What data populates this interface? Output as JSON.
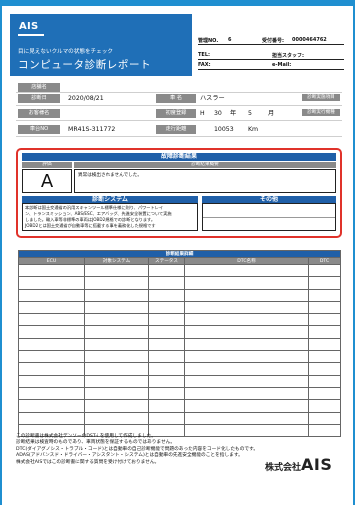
{
  "header": {
    "logo_text": "AIS",
    "tagline": "目に見えないクルマの状態をチェック",
    "title": "コンピュータ診断レポート",
    "kanri_no_label": "管理NO.",
    "kanri_no_value": "6",
    "uketsuke_label": "受付番号:",
    "uketsuke_value": "0000464762",
    "tel_label": "TEL:",
    "staff_label": "担当スタッフ:",
    "fax_label": "FAX:",
    "email_label": "e-Mail:"
  },
  "info": {
    "store_label": "店舗名",
    "date_label": "診断日",
    "date_value": "2020/08/21",
    "car_label": "車 名",
    "car_value": "ハスラー",
    "customer_label": "お客様名",
    "reg_label": "初度登録",
    "reg_era": "H",
    "reg_year": "30",
    "reg_year_unit": "年",
    "reg_month": "5",
    "reg_month_unit": "月",
    "chassis_label": "車台NO",
    "chassis_value": "MR41S-311772",
    "mileage_label": "走行距離",
    "mileage_value": "10053",
    "mileage_unit": "Km",
    "chip1": "診断実施項目",
    "chip2": "診断実行機種"
  },
  "result": {
    "title": "故障診断結果",
    "eval_label": "評価",
    "summary_label": "診断結果概要",
    "grade": "A",
    "summary_text": "異常は検出されませんでした。",
    "system_title": "診断システム",
    "system_text": [
      "本診断は国土交通省の汎用スキャンツール標準仕様に則り、パワートレイ",
      "ン、トランスミッション、ABS/ESC、エアバッグ、先進安全装置について実施",
      "しました。輸入車等非標準の車両はJOBD2規格での診断となります。",
      "JOBD2とは国土交通省が自動車等に搭載する事を義務化した規格です"
    ],
    "other_title": "その他"
  },
  "detail": {
    "title": "診断結果詳細",
    "columns": [
      "ECU",
      "対象システム",
      "ステータス",
      "DTC名称",
      "DTC"
    ],
    "row_count": 14
  },
  "notes": [
    "この診断書は株式会社デンソーのDST-i を使用して作成しました。",
    "診断結果は検査時のものであり、車両状態を保証するものではありません。",
    "DTC(ダイアグノシス・トラブル・コード)とは自動車の自己診断機能で問題のあった内容をコード化したものです。",
    "ADAS(アドバンスド・ドライバー・アシスタント・システム)とは自動車の先進安全機能のことを指します。",
    "株式会社AISではこの診断書に関する質問を受け付けておりません。"
  ],
  "brand": {
    "prefix": "株式会社",
    "name": "AIS"
  },
  "colors": {
    "accent_blue": "#1f6fb7",
    "frame_red": "#e0322a",
    "label_gray": "#8a8a8a"
  }
}
